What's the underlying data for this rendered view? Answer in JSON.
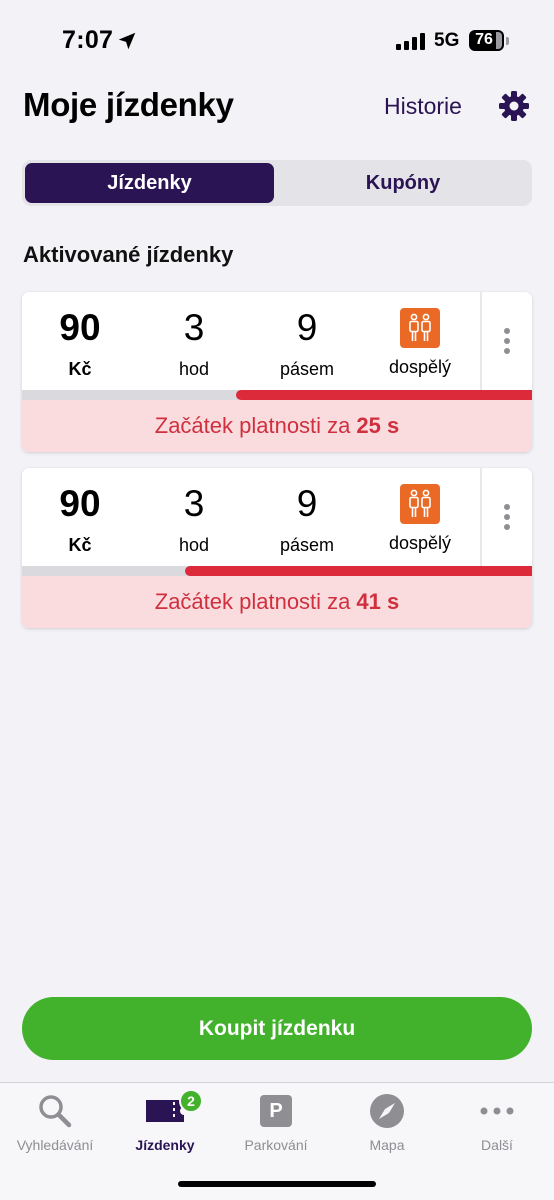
{
  "status_bar": {
    "time": "7:07",
    "network": "5G",
    "battery": "76"
  },
  "header": {
    "title": "Moje jízdenky",
    "history_label": "Historie"
  },
  "segmented": {
    "active_label": "Jízdenky",
    "inactive_label": "Kupóny"
  },
  "section_title": "Aktivované jízdenky",
  "tickets": [
    {
      "price": "90",
      "currency": "Kč",
      "duration": "3",
      "duration_unit": "hod",
      "zones": "9",
      "zones_unit": "pásem",
      "passenger_type": "dospělý",
      "validity_prefix": "Začátek platnosti za",
      "validity_countdown": "25 s",
      "progress_fraction": 0.58
    },
    {
      "price": "90",
      "currency": "Kč",
      "duration": "3",
      "duration_unit": "hod",
      "zones": "9",
      "zones_unit": "pásem",
      "passenger_type": "dospělý",
      "validity_prefix": "Začátek platnosti za",
      "validity_countdown": "41 s",
      "progress_fraction": 0.68
    }
  ],
  "buy_button_label": "Koupit jízdenku",
  "tabbar": {
    "search": "Vyhledávání",
    "tickets": "Jízdenky",
    "tickets_badge": "2",
    "parking": "Parkování",
    "parking_icon_letter": "P",
    "map": "Mapa",
    "more": "Další"
  },
  "colors": {
    "brand_purple": "#2b1453",
    "accent_green": "#42b22d",
    "alert_red": "#dc2a3a",
    "passenger_orange": "#ea6a25"
  }
}
